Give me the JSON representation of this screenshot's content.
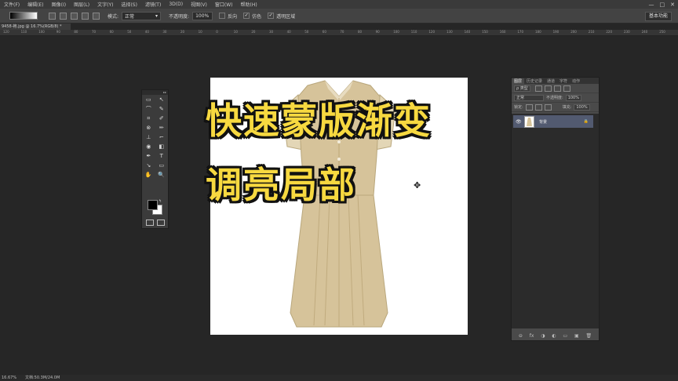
{
  "menu": {
    "items": [
      "文件(F)",
      "编辑(E)",
      "图像(I)",
      "图层(L)",
      "文字(Y)",
      "选择(S)",
      "滤镜(T)",
      "3D(D)",
      "视图(V)",
      "窗口(W)",
      "帮助(H)"
    ],
    "window_controls": [
      "—",
      "□",
      "✕"
    ]
  },
  "options_bar": {
    "mode_label": "模式:",
    "mode_value": "正常",
    "opacity_label": "不透明度:",
    "opacity_value": "100%",
    "reverse_label": "反向",
    "dither_label": "仿色",
    "transparency_label": "透明区域",
    "workspace_label": "基本功能"
  },
  "document": {
    "tab_title": "9458-袍.jpg @ 16.7%(RGB/8) *"
  },
  "ruler": {
    "ticks": [
      "120",
      "110",
      "100",
      "90",
      "80",
      "70",
      "60",
      "50",
      "40",
      "30",
      "20",
      "10",
      "0",
      "10",
      "20",
      "30",
      "40",
      "50",
      "60",
      "70",
      "80",
      "90",
      "100",
      "110",
      "120",
      "130",
      "140",
      "150",
      "160",
      "170",
      "180",
      "190",
      "200",
      "210",
      "220",
      "230",
      "240",
      "250"
    ]
  },
  "toolbox": {
    "tools": [
      [
        "▭",
        "↖"
      ],
      [
        "⌒",
        "✎"
      ],
      [
        "⌗",
        "✐"
      ],
      [
        "⊗",
        "✏"
      ],
      [
        "⊥",
        "⌐"
      ],
      [
        "◉",
        "◧"
      ],
      [
        "✒",
        "T"
      ],
      [
        "↘",
        "▭"
      ],
      [
        "✋",
        "🔍"
      ]
    ],
    "foreground_color": "#000000",
    "background_color": "#ffffff"
  },
  "canvas": {
    "headline_line1": "快速蒙版渐变",
    "headline_line2": "调亮局部",
    "headline_color": "#f7d940",
    "dress_color": "#d6c39a"
  },
  "layers_panel": {
    "tabs": [
      "图层",
      "历史记录",
      "通道",
      "字符",
      "动作"
    ],
    "kind_label": "ρ 类型",
    "blend_mode": "正常",
    "opacity_label": "不透明度:",
    "opacity_value": "100%",
    "lock_label": "锁定:",
    "fill_label": "填充:",
    "fill_value": "100%",
    "layer_name": "背景",
    "lock_icon": "🔒",
    "bottom_icons": [
      "⊖",
      "fx",
      "◑",
      "◐",
      "▭",
      "▣",
      "🗑"
    ]
  },
  "status_bar": {
    "zoom": "16.67%",
    "doc_info": "文档:50.3M/24.0M"
  }
}
